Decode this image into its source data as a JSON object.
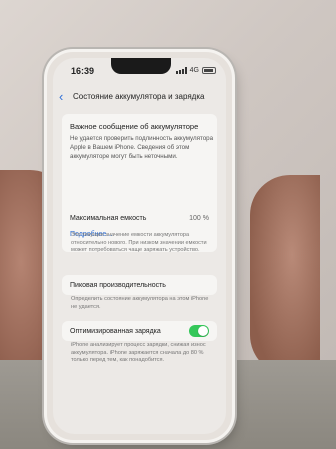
{
  "status_bar": {
    "time": "16:39",
    "network": "4G"
  },
  "nav": {
    "title": "Состояние аккумулятора и зарядка"
  },
  "warning": {
    "title": "Важное сообщение об аккумуляторе",
    "text": "Не удается проверить подлинность аккумулятора Apple в Вашем iPhone. Сведения об этом аккумуляторе могут быть неточными.",
    "more_link": "Подробнее..."
  },
  "capacity": {
    "label": "Максимальная емкость",
    "value": "100 %",
    "note": "Это текущее значение емкости аккумулятора относительно нового. При низком значении емкости может потребоваться чаще заряжать устройство."
  },
  "peak": {
    "label": "Пиковая производительность",
    "note": "Определить состояние аккумулятора на этом iPhone не удается."
  },
  "optimized": {
    "label": "Оптимизированная зарядка",
    "enabled": true,
    "note": "iPhone анализирует процесс зарядки, снижая износ аккумулятора. iPhone заряжается сначала до 80 % только перед тем, как понадобится."
  },
  "colors": {
    "accent": "#2f6fd6",
    "toggle_on": "#34c759"
  }
}
